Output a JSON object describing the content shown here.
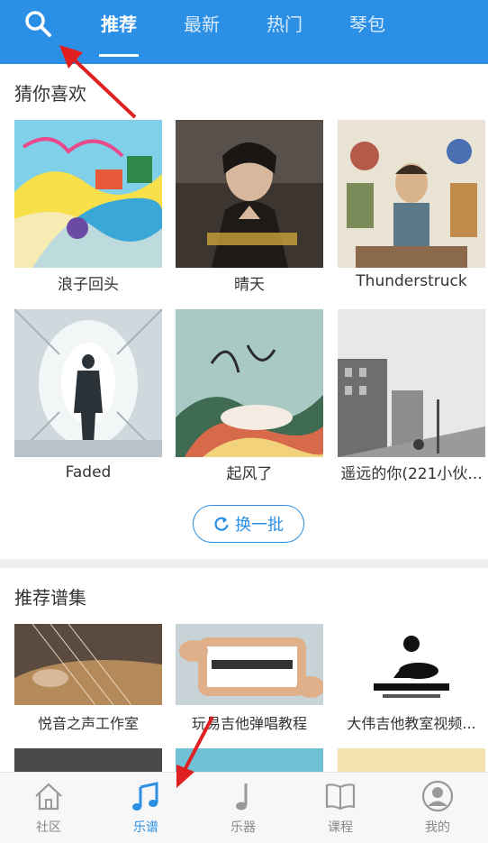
{
  "header": {
    "tabs": [
      {
        "label": "推荐",
        "active": true
      },
      {
        "label": "最新",
        "active": false
      },
      {
        "label": "热门",
        "active": false
      },
      {
        "label": "琴包",
        "active": false
      }
    ]
  },
  "guess": {
    "title": "猜你喜欢",
    "items": [
      {
        "title": "浪子回头"
      },
      {
        "title": "晴天"
      },
      {
        "title": "Thunderstruck"
      },
      {
        "title": "Faded"
      },
      {
        "title": "起风了"
      },
      {
        "title": "遥远的你(221小伙..."
      }
    ],
    "refresh_label": "换一批"
  },
  "collections": {
    "title": "推荐谱集",
    "items": [
      {
        "title": "悦音之声工作室"
      },
      {
        "title": "玩易吉他弹唱教程"
      },
      {
        "title": "大伟吉他教室视频..."
      }
    ]
  },
  "bottom_nav": [
    {
      "label": "社区",
      "icon": "home-icon",
      "active": false
    },
    {
      "label": "乐谱",
      "icon": "music-note-icon",
      "active": true
    },
    {
      "label": "乐器",
      "icon": "guitar-note-icon",
      "active": false
    },
    {
      "label": "课程",
      "icon": "book-icon",
      "active": false
    },
    {
      "label": "我的",
      "icon": "profile-icon",
      "active": false
    }
  ],
  "colors": {
    "accent": "#2b8fe6",
    "annotation": "#e02020"
  }
}
